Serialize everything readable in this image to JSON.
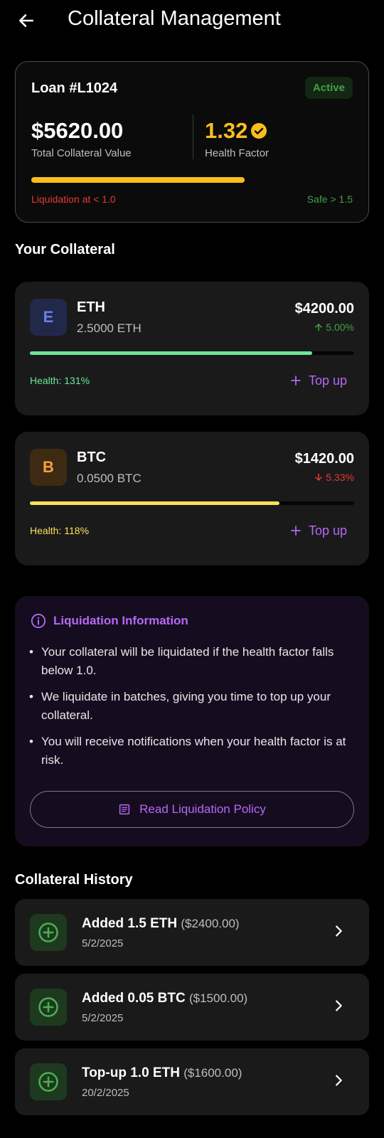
{
  "appbar": {
    "title": "Collateral Management",
    "back_icon": "arrow-left-icon"
  },
  "loan": {
    "id": "Loan #L1024",
    "status": "Active",
    "total_value": "$5620.00",
    "total_label": "Total Collateral Value",
    "health_factor": "1.32",
    "health_label": "Health Factor",
    "health_progress": 0.66,
    "liquidation_text": "Liquidation at < 1.0",
    "safe_text": "Safe > 1.5"
  },
  "collateral_section": {
    "title": "Your Collateral"
  },
  "assets": [
    {
      "avatar_letter": "E",
      "avatar_bg": "#22284a",
      "avatar_fg": "#6a7fe6",
      "symbol": "ETH",
      "amount": "2.5000 ETH",
      "usd": "$4200.00",
      "change": "5.00%",
      "change_dir": "up",
      "change_color": "#43a047",
      "health_text": "Health: 131%",
      "health_color": "#6be89a",
      "bar_color": "#6be89a",
      "health_progress": 0.87,
      "topup_label": "Top up"
    },
    {
      "avatar_letter": "B",
      "avatar_bg": "#3e2a12",
      "avatar_fg": "#f4a13b",
      "symbol": "BTC",
      "amount": "0.0500 BTC",
      "usd": "$1420.00",
      "change": "5.33%",
      "change_dir": "down",
      "change_color": "#e53935",
      "health_text": "Health: 118%",
      "health_color": "#f7e15a",
      "bar_color": "#f7e15a",
      "health_progress": 0.77,
      "topup_label": "Top up"
    }
  ],
  "info": {
    "title": "Liquidation Information",
    "points": [
      "Your collateral will be liquidated if the health factor falls below 1.0.",
      "We liquidate in batches, giving you time to top up your collateral.",
      "You will receive notifications when your health factor is at risk."
    ],
    "policy_button": "Read Liquidation Policy"
  },
  "history_section": {
    "title": "Collateral History"
  },
  "history": [
    {
      "action": "Added 1.5 ETH",
      "amount": "($2400.00)",
      "date": "5/2/2025"
    },
    {
      "action": "Added 0.05 BTC",
      "amount": "($1500.00)",
      "date": "5/2/2025"
    },
    {
      "action": "Top-up 1.0 ETH",
      "amount": "($1600.00)",
      "date": "20/2/2025"
    }
  ],
  "colors": {
    "accent": "#b668f5",
    "warning": "#fbbd1d",
    "success": "#43a047",
    "danger": "#e53935"
  }
}
